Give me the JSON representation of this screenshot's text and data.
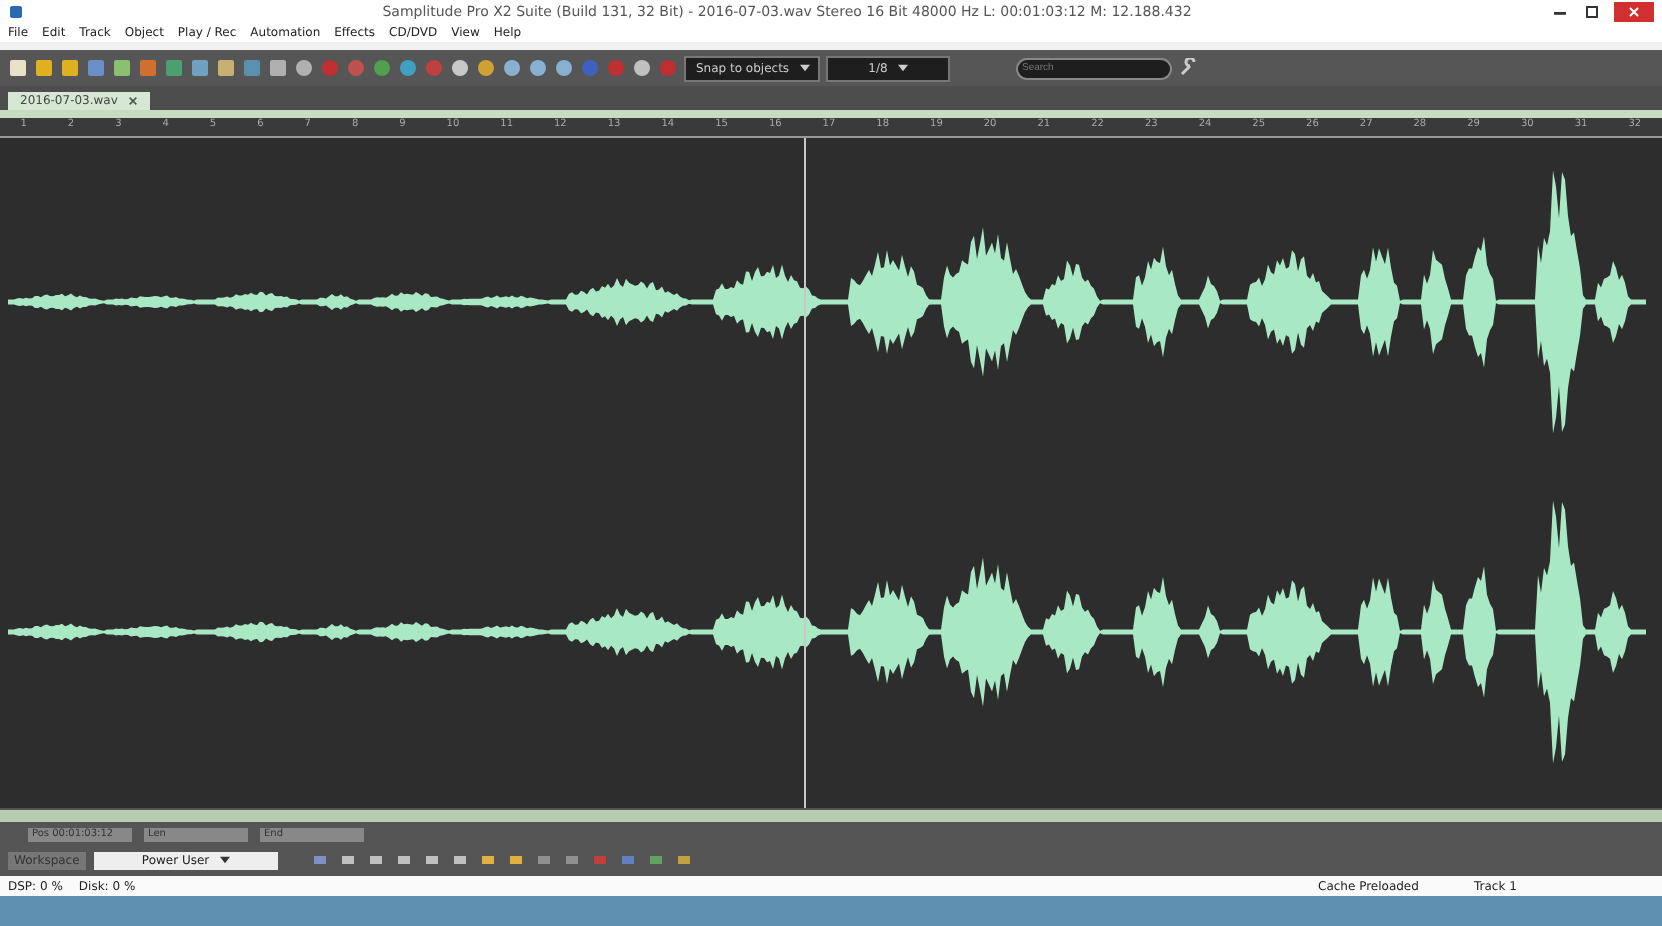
{
  "window": {
    "title": "Samplitude Pro X2 Suite (Build 131, 32 Bit) - 2016-07-03.wav  Stereo 16 Bit 48000 Hz L: 00:01:03:12 M: 12.188.432"
  },
  "menu": [
    "File",
    "Edit",
    "Track",
    "Object",
    "Play / Rec",
    "Automation",
    "Effects",
    "CD/DVD",
    "View",
    "Help"
  ],
  "toolbar": {
    "snap": "Snap to objects",
    "grid": "1/8",
    "search": {
      "placeholder": "Search"
    }
  },
  "tabs": [
    {
      "label": "2016-07-03.wav",
      "selected": true
    }
  ],
  "ruler": [
    "1",
    "2",
    "3",
    "4",
    "5",
    "6",
    "7",
    "8",
    "9",
    "10",
    "11",
    "12",
    "13",
    "14",
    "15",
    "16",
    "17",
    "18",
    "19",
    "20",
    "21",
    "22",
    "23",
    "24",
    "25",
    "26",
    "27",
    "28",
    "29",
    "30",
    "31",
    "32"
  ],
  "range": {
    "pos": "Pos 00:01:03:12",
    "len": "Len",
    "end": "End"
  },
  "workspace": {
    "label": "Workspace",
    "value": "Power User"
  },
  "status": {
    "dsp": "DSP: 0 %",
    "disk": "Disk: 0 %",
    "cache": "Cache Preloaded",
    "track": "Track 1"
  }
}
